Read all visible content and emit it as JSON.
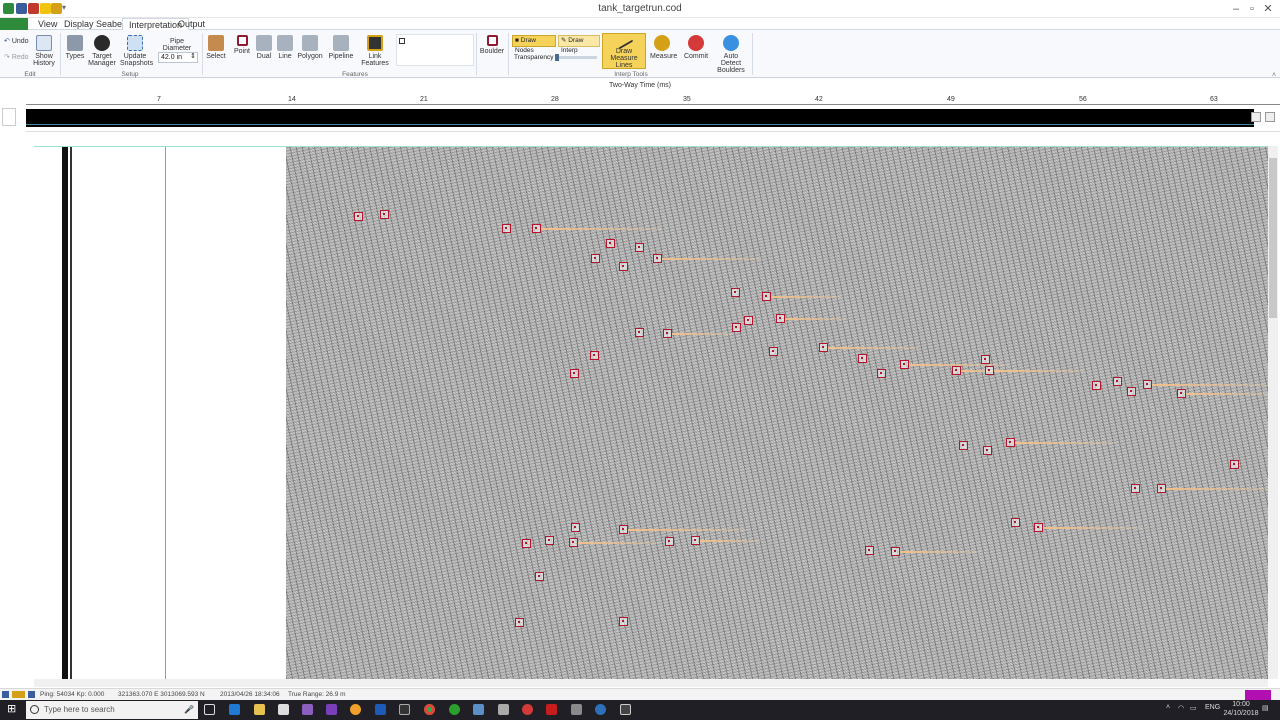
{
  "window": {
    "title": "tank_targetrun.cod"
  },
  "ribbon_tabs": [
    "View",
    "Display",
    "Seabed",
    "Interpretation",
    "Output"
  ],
  "file_tab": "",
  "ribbon": {
    "edit": {
      "undo": "Undo",
      "redo": "Redo",
      "show_history": "Show History",
      "group": "Edit"
    },
    "setup": {
      "types": "Types",
      "target_manager": "Target Manager",
      "update_snapshots": "Update Snapshots",
      "pipe_diameter_label": "Pipe Diameter",
      "pipe_diameter_value": "42.0 in",
      "group": "Setup"
    },
    "features": {
      "select": "Select",
      "point": "Point",
      "dual": "Dual",
      "line": "Line",
      "polygon": "Polygon",
      "pipeline": "Pipeline",
      "link_features": "Link Features",
      "group": "Features"
    },
    "boulder": "Boulder",
    "interp": {
      "draw_nodes": "Draw Nodes",
      "draw_interp": "Draw Interp",
      "transparency": "Transparency",
      "draw_measure_lines": "Draw Measure Lines",
      "measure": "Measure",
      "commit": "Commit",
      "auto_detect": "Auto Detect Boulders",
      "group": "Interp Tools"
    }
  },
  "ruler": {
    "label": "Two-Way Time (ms)",
    "ticks": [
      "7",
      "14",
      "21",
      "28",
      "35",
      "42",
      "49",
      "56",
      "63"
    ]
  },
  "status": {
    "ping": "Ping: 54034  Kp: 0.000",
    "position": "321363.070 E  3013069.593 N",
    "datetime": "2013/04/26 18:34:06",
    "range": "True Range: 26.9 m"
  },
  "taskbar": {
    "search_placeholder": "Type here to search",
    "time": "10:00",
    "date": "24/10/2018",
    "lang": "ENG"
  },
  "colors": {
    "accent": "#2e8b3b",
    "target": "#b3142e",
    "active_tool": "#f5d35a"
  }
}
